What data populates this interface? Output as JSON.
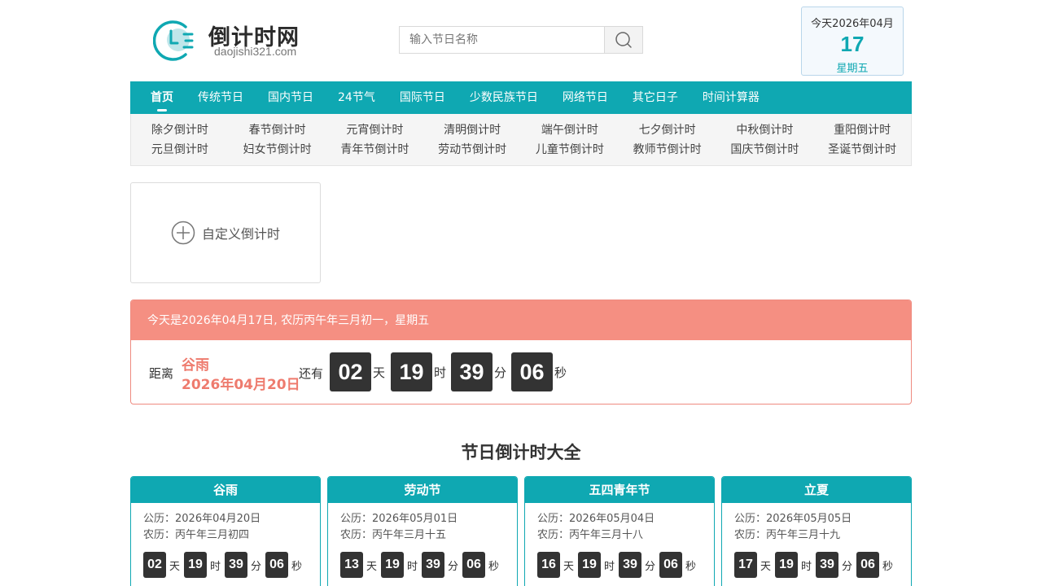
{
  "brand": {
    "title": "倒计时网",
    "subtitle": "daojishi321.com"
  },
  "search": {
    "placeholder": "输入节日名称",
    "button_icon": "search-icon"
  },
  "today_box": {
    "year_month": "今天2026年04月",
    "day": "17",
    "weekday": "星期五"
  },
  "nav": {
    "items": [
      {
        "label": "首页",
        "active": true
      },
      {
        "label": "传统节日"
      },
      {
        "label": "国内节日"
      },
      {
        "label": "24节气"
      },
      {
        "label": "国际节日"
      },
      {
        "label": "少数民族节日"
      },
      {
        "label": "网络节日"
      },
      {
        "label": "其它日子"
      },
      {
        "label": "时间计算器"
      }
    ]
  },
  "sub_nav": {
    "row1": [
      "除夕倒计时",
      "春节倒计时",
      "元宵倒计时",
      "清明倒计时",
      "端午倒计时",
      "七夕倒计时",
      "中秋倒计时",
      "重阳倒计时"
    ],
    "row2": [
      "元旦倒计时",
      "妇女节倒计时",
      "青年节倒计时",
      "劳动节倒计时",
      "儿童节倒计时",
      "教师节倒计时",
      "国庆节倒计时",
      "圣诞节倒计时"
    ]
  },
  "custom": {
    "label": "自定义倒计时",
    "icon": "plus-circle-icon"
  },
  "today_panel": {
    "header": "今天是2026年04月17日, 农历丙午年三月初一，星期五",
    "distance_label": "距离",
    "target_name": "谷雨",
    "target_date": "2026年04月20日",
    "still_label": "还有",
    "countdown": [
      {
        "value": "02",
        "unit": "天"
      },
      {
        "value": "19",
        "unit": "时"
      },
      {
        "value": "39",
        "unit": "分"
      },
      {
        "value": "06",
        "unit": "秒"
      }
    ]
  },
  "section": {
    "title": "节日倒计时大全"
  },
  "festivals": [
    {
      "name": "谷雨",
      "solar": "公历：2026年04月20日",
      "lunar": "农历：丙午年三月初四",
      "countdown": [
        {
          "value": "02",
          "unit": "天"
        },
        {
          "value": "19",
          "unit": "时"
        },
        {
          "value": "39",
          "unit": "分"
        },
        {
          "value": "06",
          "unit": "秒"
        }
      ]
    },
    {
      "name": "劳动节",
      "solar": "公历：2026年05月01日",
      "lunar": "农历：丙午年三月十五",
      "countdown": [
        {
          "value": "13",
          "unit": "天"
        },
        {
          "value": "19",
          "unit": "时"
        },
        {
          "value": "39",
          "unit": "分"
        },
        {
          "value": "06",
          "unit": "秒"
        }
      ]
    },
    {
      "name": "五四青年节",
      "solar": "公历：2026年05月04日",
      "lunar": "农历：丙午年三月十八",
      "countdown": [
        {
          "value": "16",
          "unit": "天"
        },
        {
          "value": "19",
          "unit": "时"
        },
        {
          "value": "39",
          "unit": "分"
        },
        {
          "value": "06",
          "unit": "秒"
        }
      ]
    },
    {
      "name": "立夏",
      "solar": "公历：2026年05月05日",
      "lunar": "农历：丙午年三月十九",
      "countdown": [
        {
          "value": "17",
          "unit": "天"
        },
        {
          "value": "19",
          "unit": "时"
        },
        {
          "value": "39",
          "unit": "分"
        },
        {
          "value": "06",
          "unit": "秒"
        }
      ]
    }
  ],
  "colors": {
    "accent": "#0fa8b2",
    "banner": "#f58f82",
    "target_text": "#ee7b6e",
    "counter_bg": "#333333"
  }
}
